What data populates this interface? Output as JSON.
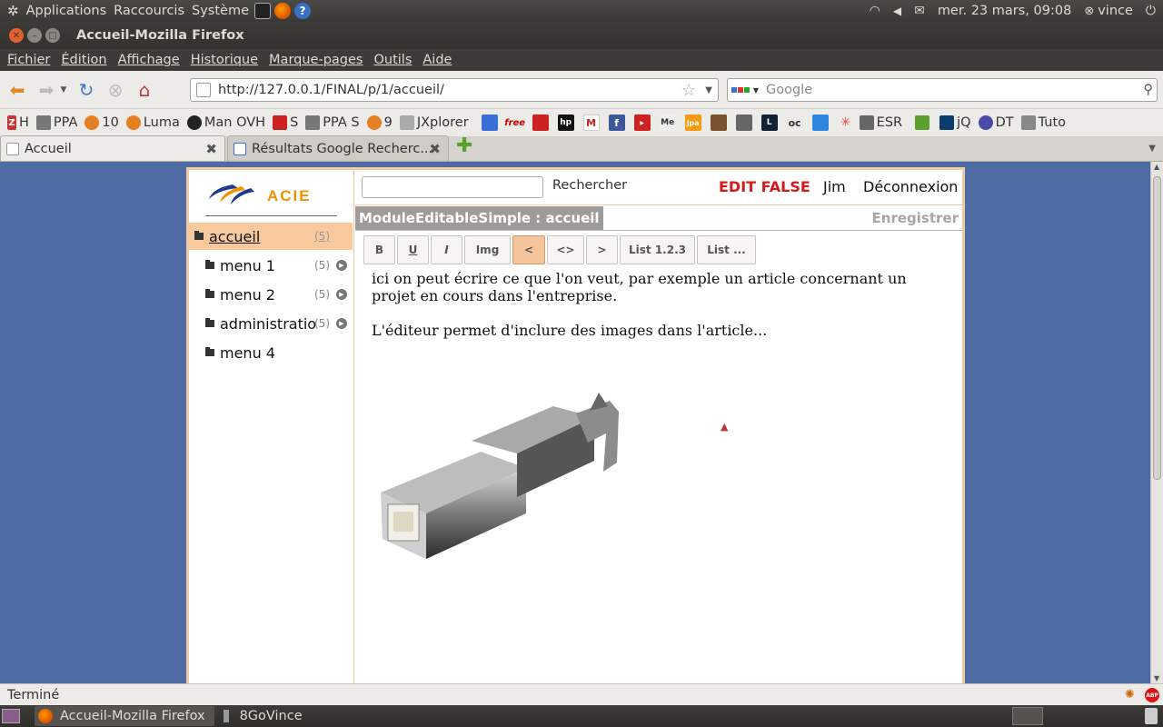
{
  "panel": {
    "applications": "Applications",
    "shortcuts": "Raccourcis",
    "system": "Système",
    "datetime": "mer. 23 mars, 09:08",
    "user": "vince"
  },
  "window": {
    "title": "Accueil-Mozilla Firefox"
  },
  "menu": [
    "Fichier",
    "Édition",
    "Affichage",
    "Historique",
    "Marque-pages",
    "Outils",
    "Aide"
  ],
  "nav": {
    "url": "http://127.0.0.1/FINAL/p/1/accueil/",
    "search_placeholder": "Google"
  },
  "bookmarks": {
    "labeled": [
      "H",
      "PPA",
      "10",
      "Luma",
      "Man OVH",
      "S",
      "PPA S",
      "9",
      "JXplorer"
    ],
    "icon_only": [
      "free",
      "hp",
      "jpa",
      "oc"
    ],
    "tail": [
      "ESR",
      "jQ",
      "DT",
      "Tuto"
    ]
  },
  "tabs": [
    {
      "label": "Accueil",
      "active": true
    },
    {
      "label": "Résultats Google Recherc...",
      "active": false
    }
  ],
  "page": {
    "logo_text": "ACIE",
    "search_button": "Rechercher",
    "edit_state": "EDIT FALSE",
    "user": "Jim",
    "logout": "Déconnexion",
    "module_title": "ModuleEditableSimple : accueil",
    "save": "Enregistrer",
    "tree": [
      {
        "label": "accueil",
        "count": "(5)"
      },
      {
        "label": "menu 1",
        "count": "(5)"
      },
      {
        "label": "menu 2",
        "count": "(5)"
      },
      {
        "label": "administratio",
        "count": "(5)"
      },
      {
        "label": "menu 4",
        "count": ""
      }
    ],
    "toolbar": [
      "B",
      "U",
      "I",
      "Img",
      "<",
      "<>",
      ">",
      "List 1.2.3",
      "List ..."
    ],
    "paragraph1": "ici on peut écrire ce que l'on veut, par exemple un article concernant un projet en cours dans l'entreprise.",
    "paragraph2": "L'éditeur permet d'inclure des images dans l'article..."
  },
  "status": {
    "text": "Terminé"
  },
  "taskbar": [
    {
      "label": "Accueil-Mozilla Firefox",
      "active": true
    },
    {
      "label": "8GoVince",
      "active": false
    }
  ],
  "colors": {
    "accent": "#f7c99c",
    "edit_state": "#d31b1b",
    "page_background": "#4f6ba4"
  }
}
